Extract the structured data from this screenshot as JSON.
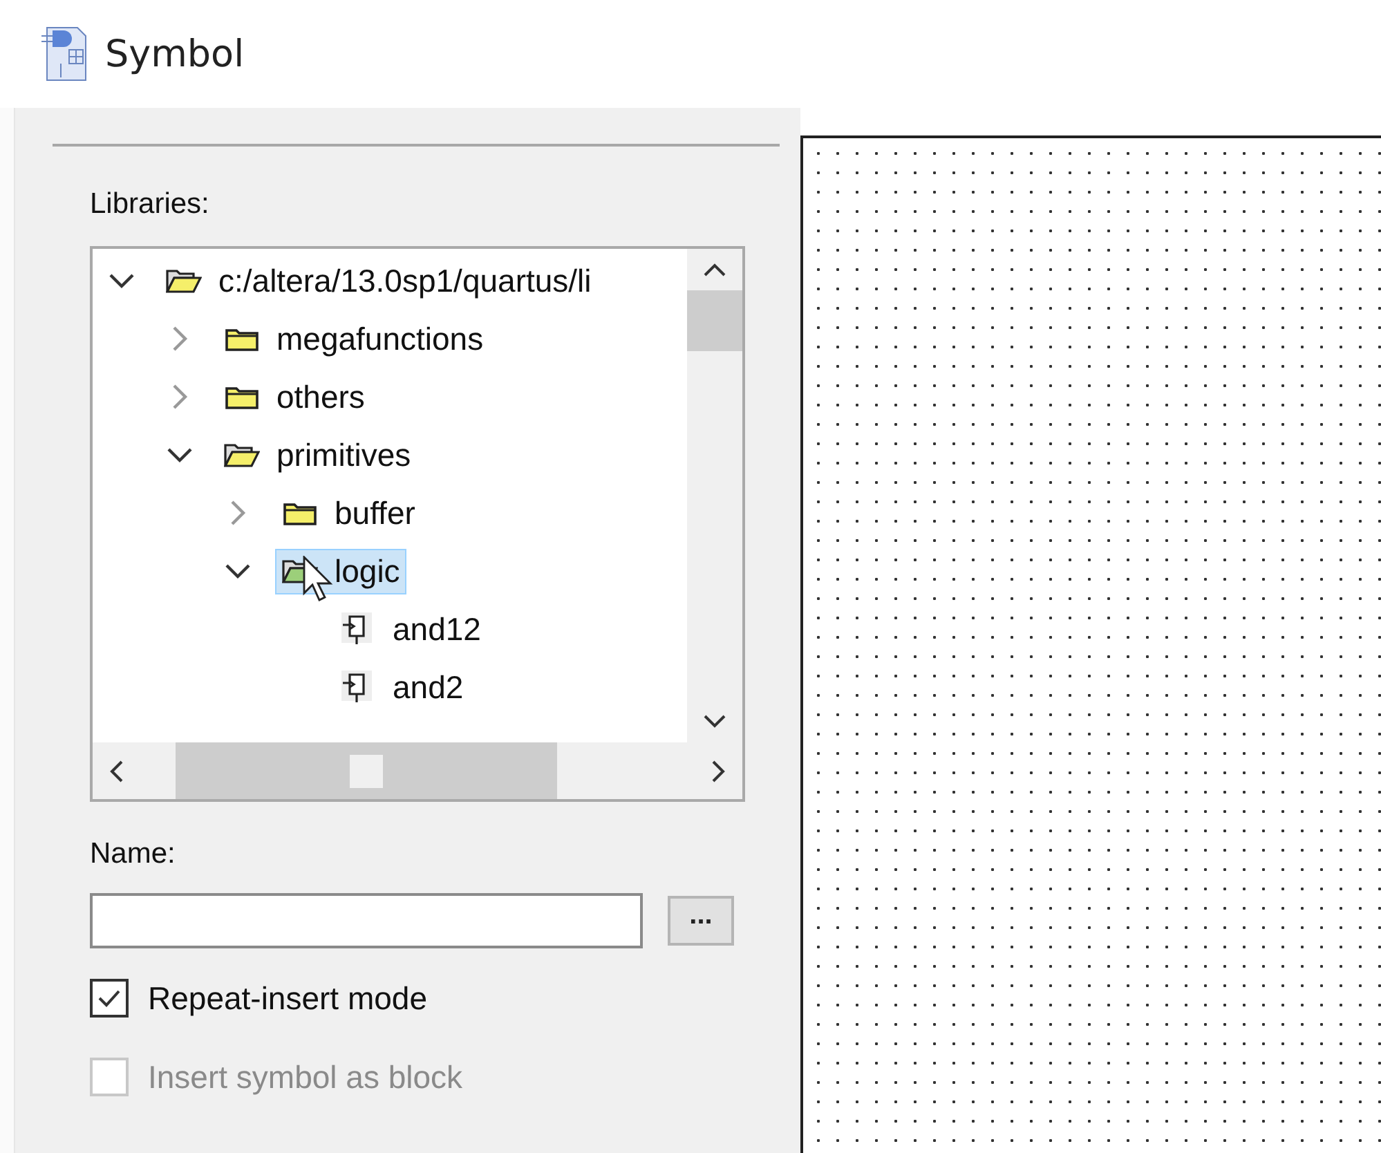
{
  "window": {
    "title": "Symbol"
  },
  "libraries": {
    "label": "Libraries:",
    "tree": [
      {
        "label": "c:/altera/13.0sp1/quartus/li",
        "kind": "folder",
        "expanded": true,
        "selected": false,
        "children": [
          {
            "label": "megafunctions",
            "kind": "folder",
            "expanded": false,
            "selected": false
          },
          {
            "label": "others",
            "kind": "folder",
            "expanded": false,
            "selected": false
          },
          {
            "label": "primitives",
            "kind": "folder",
            "expanded": true,
            "selected": false,
            "children": [
              {
                "label": "buffer",
                "kind": "folder",
                "expanded": false,
                "selected": false
              },
              {
                "label": "logic",
                "kind": "folder",
                "expanded": true,
                "selected": true,
                "children": [
                  {
                    "label": "and12",
                    "kind": "symbol",
                    "selected": false
                  },
                  {
                    "label": "and2",
                    "kind": "symbol",
                    "selected": false
                  }
                ]
              }
            ]
          }
        ]
      }
    ]
  },
  "name": {
    "label": "Name:",
    "browse_button": "..."
  },
  "options": [
    {
      "label": "Repeat-insert mode",
      "checked": true,
      "disabled": false
    },
    {
      "label": "Insert symbol as block",
      "checked": false,
      "disabled": true
    }
  ]
}
